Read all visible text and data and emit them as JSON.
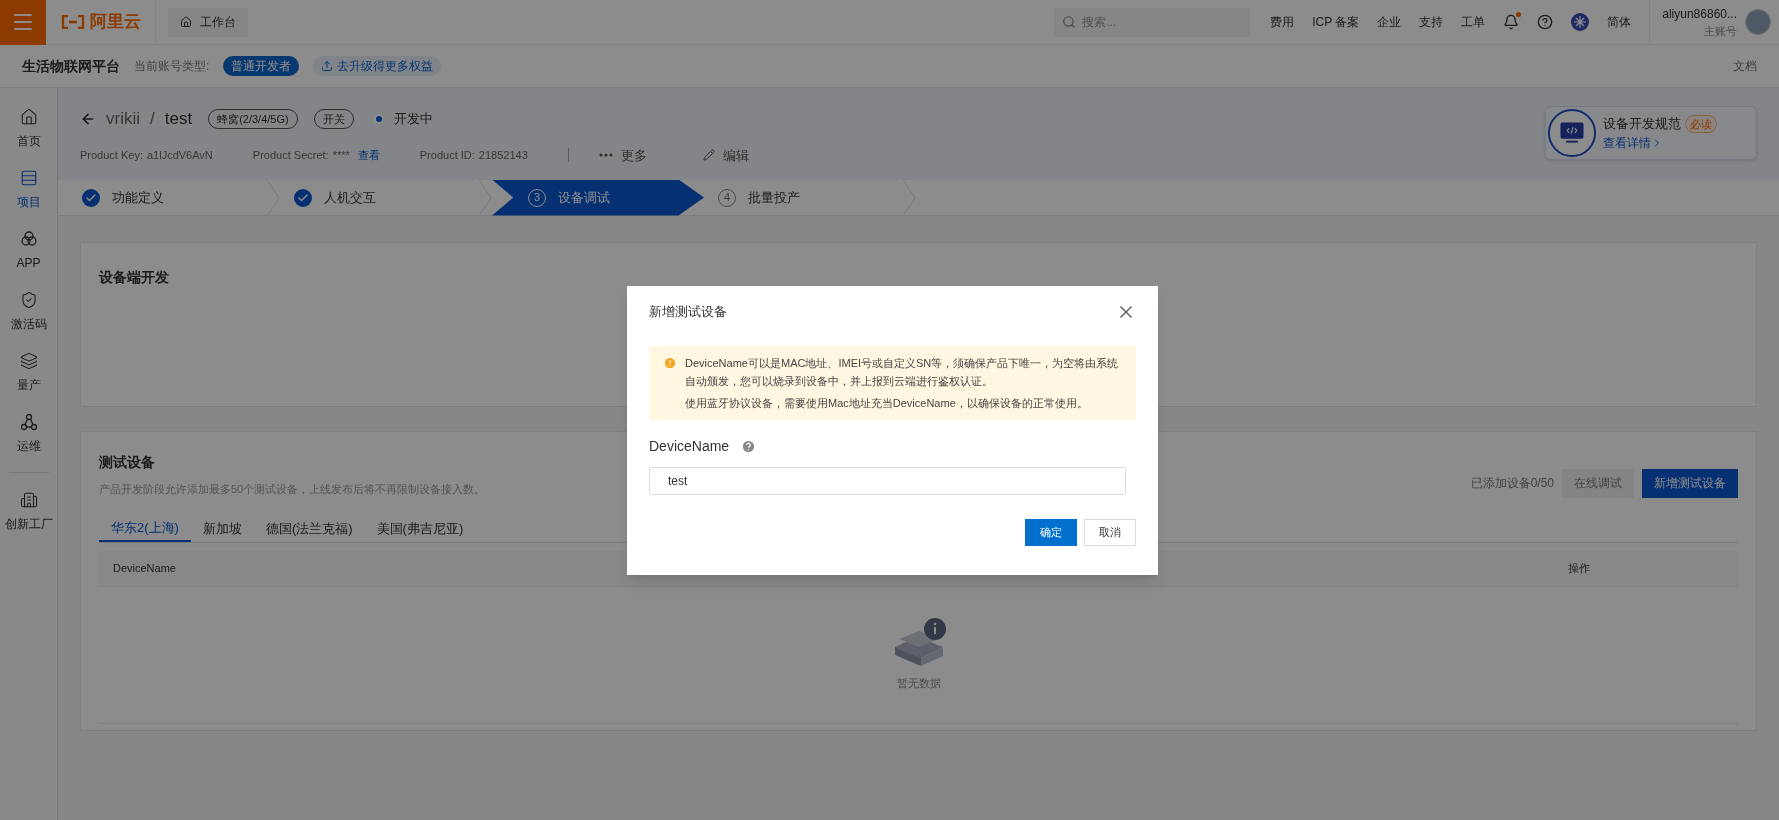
{
  "topbar": {
    "logo": "阿里云",
    "workbench": "工作台",
    "search": {
      "placeholder": "搜索..."
    },
    "links": [
      "费用",
      "ICP 备案",
      "企业",
      "支持",
      "工单"
    ],
    "bell": {
      "unread": true
    },
    "language": "简体",
    "user": {
      "name": "aliyun86860...",
      "role": "主账号"
    }
  },
  "subheader": {
    "platform": "生活物联网平台",
    "account_label": "当前账号类型:",
    "account_type": "普通开发者",
    "upgrade": "去升级得更多权益",
    "docs": "文档"
  },
  "sidebar": {
    "items": [
      {
        "kind": "home",
        "label": "首页",
        "selected": false
      },
      {
        "kind": "project",
        "label": "项目",
        "selected": true
      },
      {
        "kind": "app",
        "label": "APP",
        "selected": false
      },
      {
        "kind": "activation",
        "label": "激活码",
        "selected": false
      },
      {
        "kind": "production",
        "label": "量产",
        "selected": false
      },
      {
        "kind": "ops",
        "label": "运维",
        "selected": false
      },
      {
        "kind": "factory",
        "label": "创新工厂",
        "selected": false
      }
    ]
  },
  "product": {
    "owner": "vrikii",
    "separator": "/",
    "name": "test",
    "tags": [
      "蜂窝(2/3/4/5G)",
      "开关"
    ],
    "status": "开发中",
    "meta": [
      {
        "label": "Product Key:",
        "value": "a1lJcdV6AvN"
      },
      {
        "label": "Product Secret:",
        "value": "****",
        "link": "查看"
      },
      {
        "label": "Product ID:",
        "value": "21852143"
      }
    ],
    "actions": [
      {
        "kind": "more",
        "label": "更多"
      },
      {
        "kind": "edit",
        "label": "编辑"
      }
    ]
  },
  "promo": {
    "title": "设备开发规范",
    "badge": "必读",
    "link": "查看详情"
  },
  "steps": [
    {
      "completed": true,
      "selected": false,
      "label": "功能定义"
    },
    {
      "completed": true,
      "selected": false,
      "label": "人机交互"
    },
    {
      "completed": false,
      "selected": true,
      "number": "3",
      "label": "设备调试"
    },
    {
      "completed": false,
      "selected": false,
      "number": "4",
      "label": "批量投产"
    }
  ],
  "device_dev": {
    "title": "设备端开发"
  },
  "test_devices": {
    "title": "测试设备",
    "description": "产品开发阶段允许添加最多50个测试设备，上线发布后将不再限制设备接入数。",
    "count": "已添加设备0/50",
    "buttons": [
      {
        "label": "在线调试",
        "primary": false,
        "disabled": true
      },
      {
        "label": "新增测试设备",
        "primary": true,
        "disabled": false
      }
    ],
    "regions": [
      {
        "label": "华东2(上海)",
        "selected": true
      },
      {
        "label": "新加坡",
        "selected": false
      },
      {
        "label": "德国(法兰克福)",
        "selected": false
      },
      {
        "label": "美国(弗吉尼亚)",
        "selected": false
      }
    ],
    "columns": [
      "DeviceName",
      "操作"
    ],
    "empty_text": "暂无数据"
  },
  "dialog": {
    "title": "新增测试设备",
    "notice": [
      "DeviceName可以是MAC地址、IMEI号或自定义SN等，须确保产品下唯一，为空将由系统自动颁发，您可以烧录到设备中，并上报到云端进行鉴权认证。",
      "使用蓝牙协议设备，需要使用Mac地址充当DeviceName，以确保设备的正常使用。"
    ],
    "field": {
      "label": "DeviceName",
      "value": "test"
    },
    "buttons": [
      {
        "label": "确定",
        "primary": true
      },
      {
        "label": "取消",
        "primary": false
      }
    ]
  }
}
